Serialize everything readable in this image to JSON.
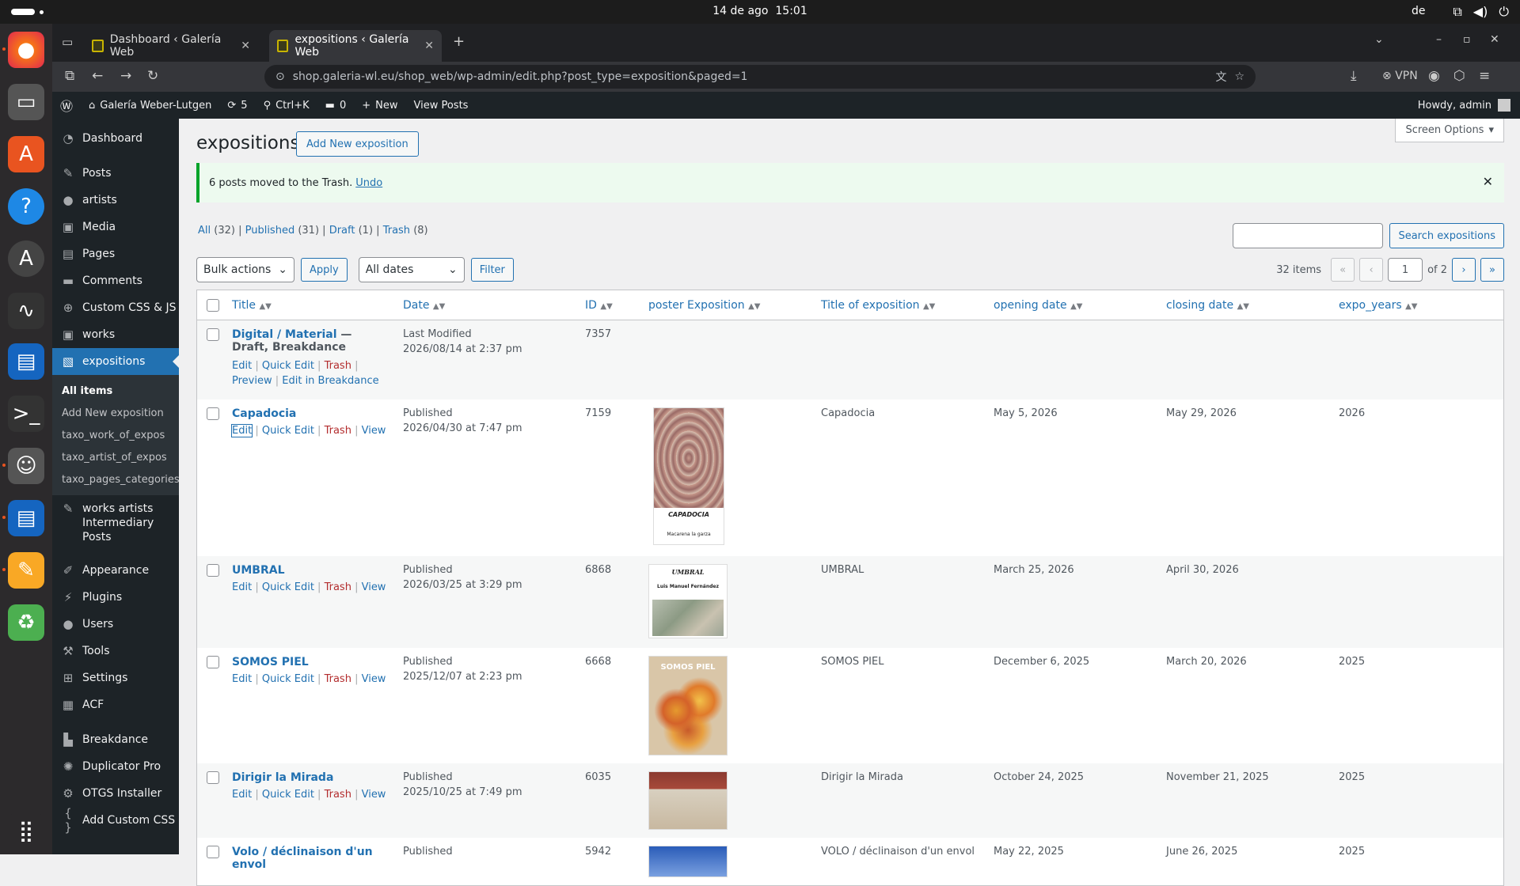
{
  "os": {
    "date": "14 de ago",
    "time": "15:01",
    "lang": "de"
  },
  "browser": {
    "tabs": [
      {
        "label": "Dashboard ‹ Galería Web"
      },
      {
        "label": "expositions ‹ Galería Web"
      }
    ],
    "url_domain": "shop.galeria-wl.eu",
    "url_path": "/shop_web/wp-admin/edit.php?post_type=exposition&paged=1",
    "vpn": "VPN"
  },
  "wpbar": {
    "site": "Galería Weber-Lutgen",
    "updates": "5",
    "shortcut": "Ctrl+K",
    "comments": "0",
    "new": "New",
    "view": "View Posts",
    "howdy": "Howdy, admin"
  },
  "sidebar": {
    "items": [
      {
        "label": "Dashboard",
        "icon": "dashboard-icon",
        "g": "◔"
      },
      {
        "label": "Posts",
        "icon": "pin-icon",
        "g": "✎"
      },
      {
        "label": "artists",
        "icon": "user-icon",
        "g": "●"
      },
      {
        "label": "Media",
        "icon": "media-icon",
        "g": "▣"
      },
      {
        "label": "Pages",
        "icon": "pages-icon",
        "g": "▤"
      },
      {
        "label": "Comments",
        "icon": "comment-icon",
        "g": "▬"
      },
      {
        "label": "Custom CSS & JS",
        "icon": "plus-icon",
        "g": "⊕"
      },
      {
        "label": "works",
        "icon": "media-icon",
        "g": "▣"
      },
      {
        "label": "expositions",
        "icon": "gallery-icon",
        "g": "▧"
      }
    ],
    "sub": [
      "All items",
      "Add New exposition",
      "taxo_work_of_expos",
      "taxo_artist_of_expos",
      "taxo_pages_categories"
    ],
    "items2": [
      {
        "label": "works artists Intermediary Posts",
        "icon": "pin-icon",
        "g": "✎"
      },
      {
        "label": "Appearance",
        "icon": "brush-icon",
        "g": "✐"
      },
      {
        "label": "Plugins",
        "icon": "plugin-icon",
        "g": "⚡"
      },
      {
        "label": "Users",
        "icon": "user-icon",
        "g": "●"
      },
      {
        "label": "Tools",
        "icon": "wrench-icon",
        "g": "⚒"
      },
      {
        "label": "Settings",
        "icon": "settings-icon",
        "g": "⊞"
      },
      {
        "label": "ACF",
        "icon": "acf-icon",
        "g": "▦"
      },
      {
        "label": "Breakdance",
        "icon": "breakdance-icon",
        "g": "▙"
      },
      {
        "label": "Duplicator Pro",
        "icon": "duplicator-icon",
        "g": "✺"
      },
      {
        "label": "OTGS Installer",
        "icon": "gear-icon",
        "g": "⚙"
      },
      {
        "label": "Add Custom CSS",
        "icon": "braces-icon",
        "g": "{ }"
      }
    ]
  },
  "page": {
    "title": "expositions",
    "add_new": "Add New exposition",
    "screen_options": "Screen Options",
    "notice": "6 posts moved to the Trash.",
    "undo": "Undo",
    "filters": {
      "all": "All",
      "all_n": "(32)",
      "pub": "Published",
      "pub_n": "(31)",
      "draft": "Draft",
      "draft_n": "(1)",
      "trash": "Trash",
      "trash_n": "(8)"
    },
    "search_btn": "Search expositions",
    "bulk": "Bulk actions",
    "apply": "Apply",
    "dates": "All dates",
    "filter": "Filter",
    "items": "32 items",
    "page_num": "1",
    "of": "of 2"
  },
  "columns": [
    "Title",
    "Date",
    "ID",
    "poster Exposition",
    "Title of exposition",
    "opening date",
    "closing date",
    "expo_years"
  ],
  "rows": [
    {
      "title": "Digital / Material",
      "state": " — Draft, Breakdance",
      "status": "Last Modified",
      "datetime": "2026/08/14 at 2:37 pm",
      "id": "7357",
      "toe": "",
      "open": "",
      "close": "",
      "year": "",
      "actions": [
        "Edit",
        "Quick Edit",
        "Trash",
        "Preview",
        "Edit in Breakdance"
      ]
    },
    {
      "title": "Capadocia",
      "state": "",
      "status": "Published",
      "datetime": "2026/04/30 at 7:47 pm",
      "id": "7159",
      "toe": "Capadocia",
      "open": "May 5, 2026",
      "close": "May 29, 2026",
      "year": "2026",
      "actions": [
        "Edit",
        "Quick Edit",
        "Trash",
        "View"
      ],
      "poster_text": [
        "CAPADOCIA",
        "Macarena la garza"
      ]
    },
    {
      "title": "UMBRAL",
      "state": "",
      "status": "Published",
      "datetime": "2026/03/25 at 3:29 pm",
      "id": "6868",
      "toe": "UMBRAL",
      "open": "March 25, 2026",
      "close": "April 30, 2026",
      "year": "",
      "actions": [
        "Edit",
        "Quick Edit",
        "Trash",
        "View"
      ],
      "poster_text": [
        "UMBRAL",
        "Luis Manuel Fernández"
      ]
    },
    {
      "title": "SOMOS PIEL",
      "state": "",
      "status": "Published",
      "datetime": "2025/12/07 at 2:23 pm",
      "id": "6668",
      "toe": "SOMOS PIEL",
      "open": "December 6, 2025",
      "close": "March 20, 2026",
      "year": "2025",
      "actions": [
        "Edit",
        "Quick Edit",
        "Trash",
        "View"
      ],
      "poster_text": [
        "SOMOS PIEL"
      ]
    },
    {
      "title": "Dirigir la Mirada",
      "state": "",
      "status": "Published",
      "datetime": "2025/10/25 at 7:49 pm",
      "id": "6035",
      "toe": "Dirigir la Mirada",
      "open": "October 24, 2025",
      "close": "November 21, 2025",
      "year": "2025",
      "actions": [
        "Edit",
        "Quick Edit",
        "Trash",
        "View"
      ]
    },
    {
      "title": "Volo / déclinaison d'un envol",
      "state": "",
      "status": "Published",
      "datetime": "",
      "id": "5942",
      "toe": "VOLO / déclinaison d'un envol",
      "open": "May 22, 2025",
      "close": "June 26, 2025",
      "year": "2025",
      "actions": []
    }
  ]
}
